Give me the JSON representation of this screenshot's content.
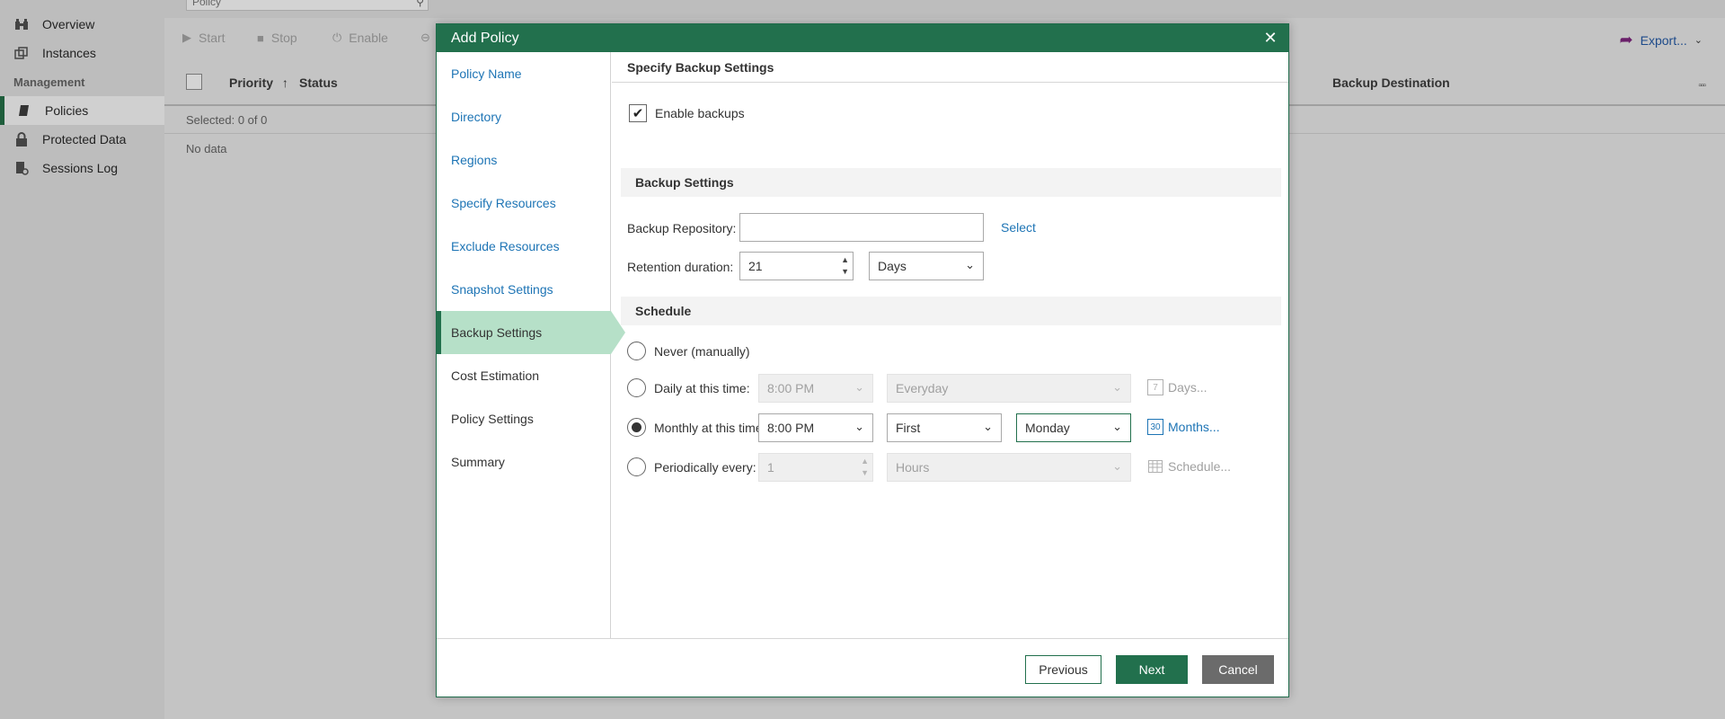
{
  "sidebar": {
    "section_label": "Management",
    "items": [
      {
        "label": "Overview",
        "icon": "binoculars-icon"
      },
      {
        "label": "Instances",
        "icon": "instances-icon"
      },
      {
        "label": "Policies",
        "icon": "policy-icon",
        "active": true
      },
      {
        "label": "Protected Data",
        "icon": "lock-icon"
      },
      {
        "label": "Sessions Log",
        "icon": "log-icon"
      }
    ]
  },
  "main": {
    "search_value": "Policy",
    "toolbar": {
      "start": "Start",
      "stop": "Stop",
      "enable": "Enable",
      "export": "Export..."
    },
    "grid": {
      "columns": [
        "Priority",
        "Status",
        "Backup Destination"
      ],
      "selected_text": "Selected:  0 of 0",
      "empty_text": "No data"
    }
  },
  "dialog": {
    "title": "Add Policy",
    "steps": [
      {
        "label": "Policy Name",
        "state": "link"
      },
      {
        "label": "Directory",
        "state": "link"
      },
      {
        "label": "Regions",
        "state": "link"
      },
      {
        "label": "Specify Resources",
        "state": "link"
      },
      {
        "label": "Exclude Resources",
        "state": "link"
      },
      {
        "label": "Snapshot Settings",
        "state": "link"
      },
      {
        "label": "Backup Settings",
        "state": "active"
      },
      {
        "label": "Cost Estimation",
        "state": "plain"
      },
      {
        "label": "Policy Settings",
        "state": "plain"
      },
      {
        "label": "Summary",
        "state": "plain"
      }
    ],
    "content_title": "Specify Backup Settings",
    "enable_backups": {
      "label": "Enable backups",
      "checked": true
    },
    "backup_settings": {
      "section_title": "Backup Settings",
      "repository_label": "Backup Repository:",
      "repository_value": "",
      "select_link": "Select",
      "retention_label": "Retention duration:",
      "retention_value": "21",
      "retention_unit": "Days"
    },
    "schedule": {
      "section_title": "Schedule",
      "never_label": "Never (manually)",
      "daily_label": "Daily at this time:",
      "daily_time": "8:00 PM",
      "daily_days": "Everyday",
      "daily_link": "Days...",
      "monthly_label": "Monthly at this time:",
      "monthly_time": "8:00 PM",
      "monthly_week": "First",
      "monthly_day": "Monday",
      "monthly_link": "Months...",
      "periodic_label": "Periodically every:",
      "periodic_value": "1",
      "periodic_unit": "Hours",
      "periodic_link": "Schedule...",
      "selected_option": "monthly",
      "calendar_icon_daily_text": "7",
      "calendar_icon_monthly_text": "30"
    },
    "buttons": {
      "previous": "Previous",
      "next": "Next",
      "cancel": "Cancel"
    },
    "colors": {
      "accent": "#22704d",
      "active_step": "#b6e0c8",
      "link": "#1d74b5"
    }
  }
}
